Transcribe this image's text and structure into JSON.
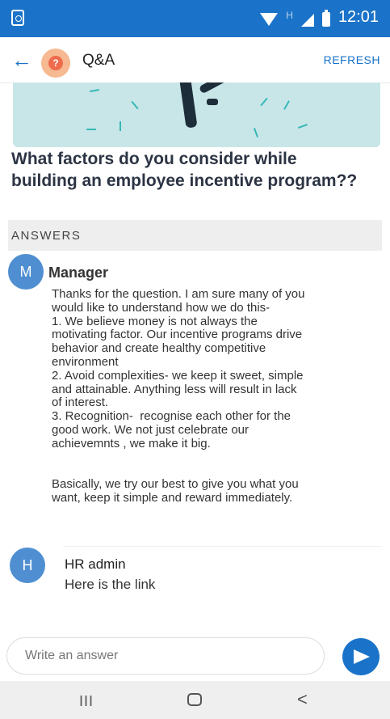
{
  "status_bar": {
    "time": "12:01",
    "network_type": "H"
  },
  "app_bar": {
    "avatar_symbol": "?",
    "title": "Q&A",
    "refresh_label": "REFRESH"
  },
  "question": {
    "title": "What factors do you consider while building an employee incentive program??"
  },
  "answers_section": {
    "header": "ANSWERS"
  },
  "answers": [
    {
      "avatar_letter": "M",
      "author": "Manager",
      "text": "Thanks for the question. I am sure many of you\nwould like to understand how we do this-\n1. We believe money is not always the\nmotivating factor. Our incentive programs drive\nbehavior and create healthy competitive\nenvironment\n2. Avoid complexities- we keep it sweet, simple\nand attainable. Anything less will result in lack\nof interest.\n3. Recognition-  recognise each other for the\ngood work. We not just celebrate our\nachievemnts , we make it big.\n\n\nBasically, we try our best to give you what you\nwant, keep it simple and reward immediately."
    },
    {
      "avatar_letter": "H",
      "author": "HR admin",
      "text": "Here is the link"
    }
  ],
  "composer": {
    "placeholder": "Write an answer",
    "send_icon": "send-icon"
  },
  "nav_bar": {
    "recents_symbol": "III",
    "back_symbol": "<"
  },
  "colors": {
    "primary": "#1a73c8",
    "avatar": "#4f8fd1",
    "banner": "#c8e6e8"
  }
}
